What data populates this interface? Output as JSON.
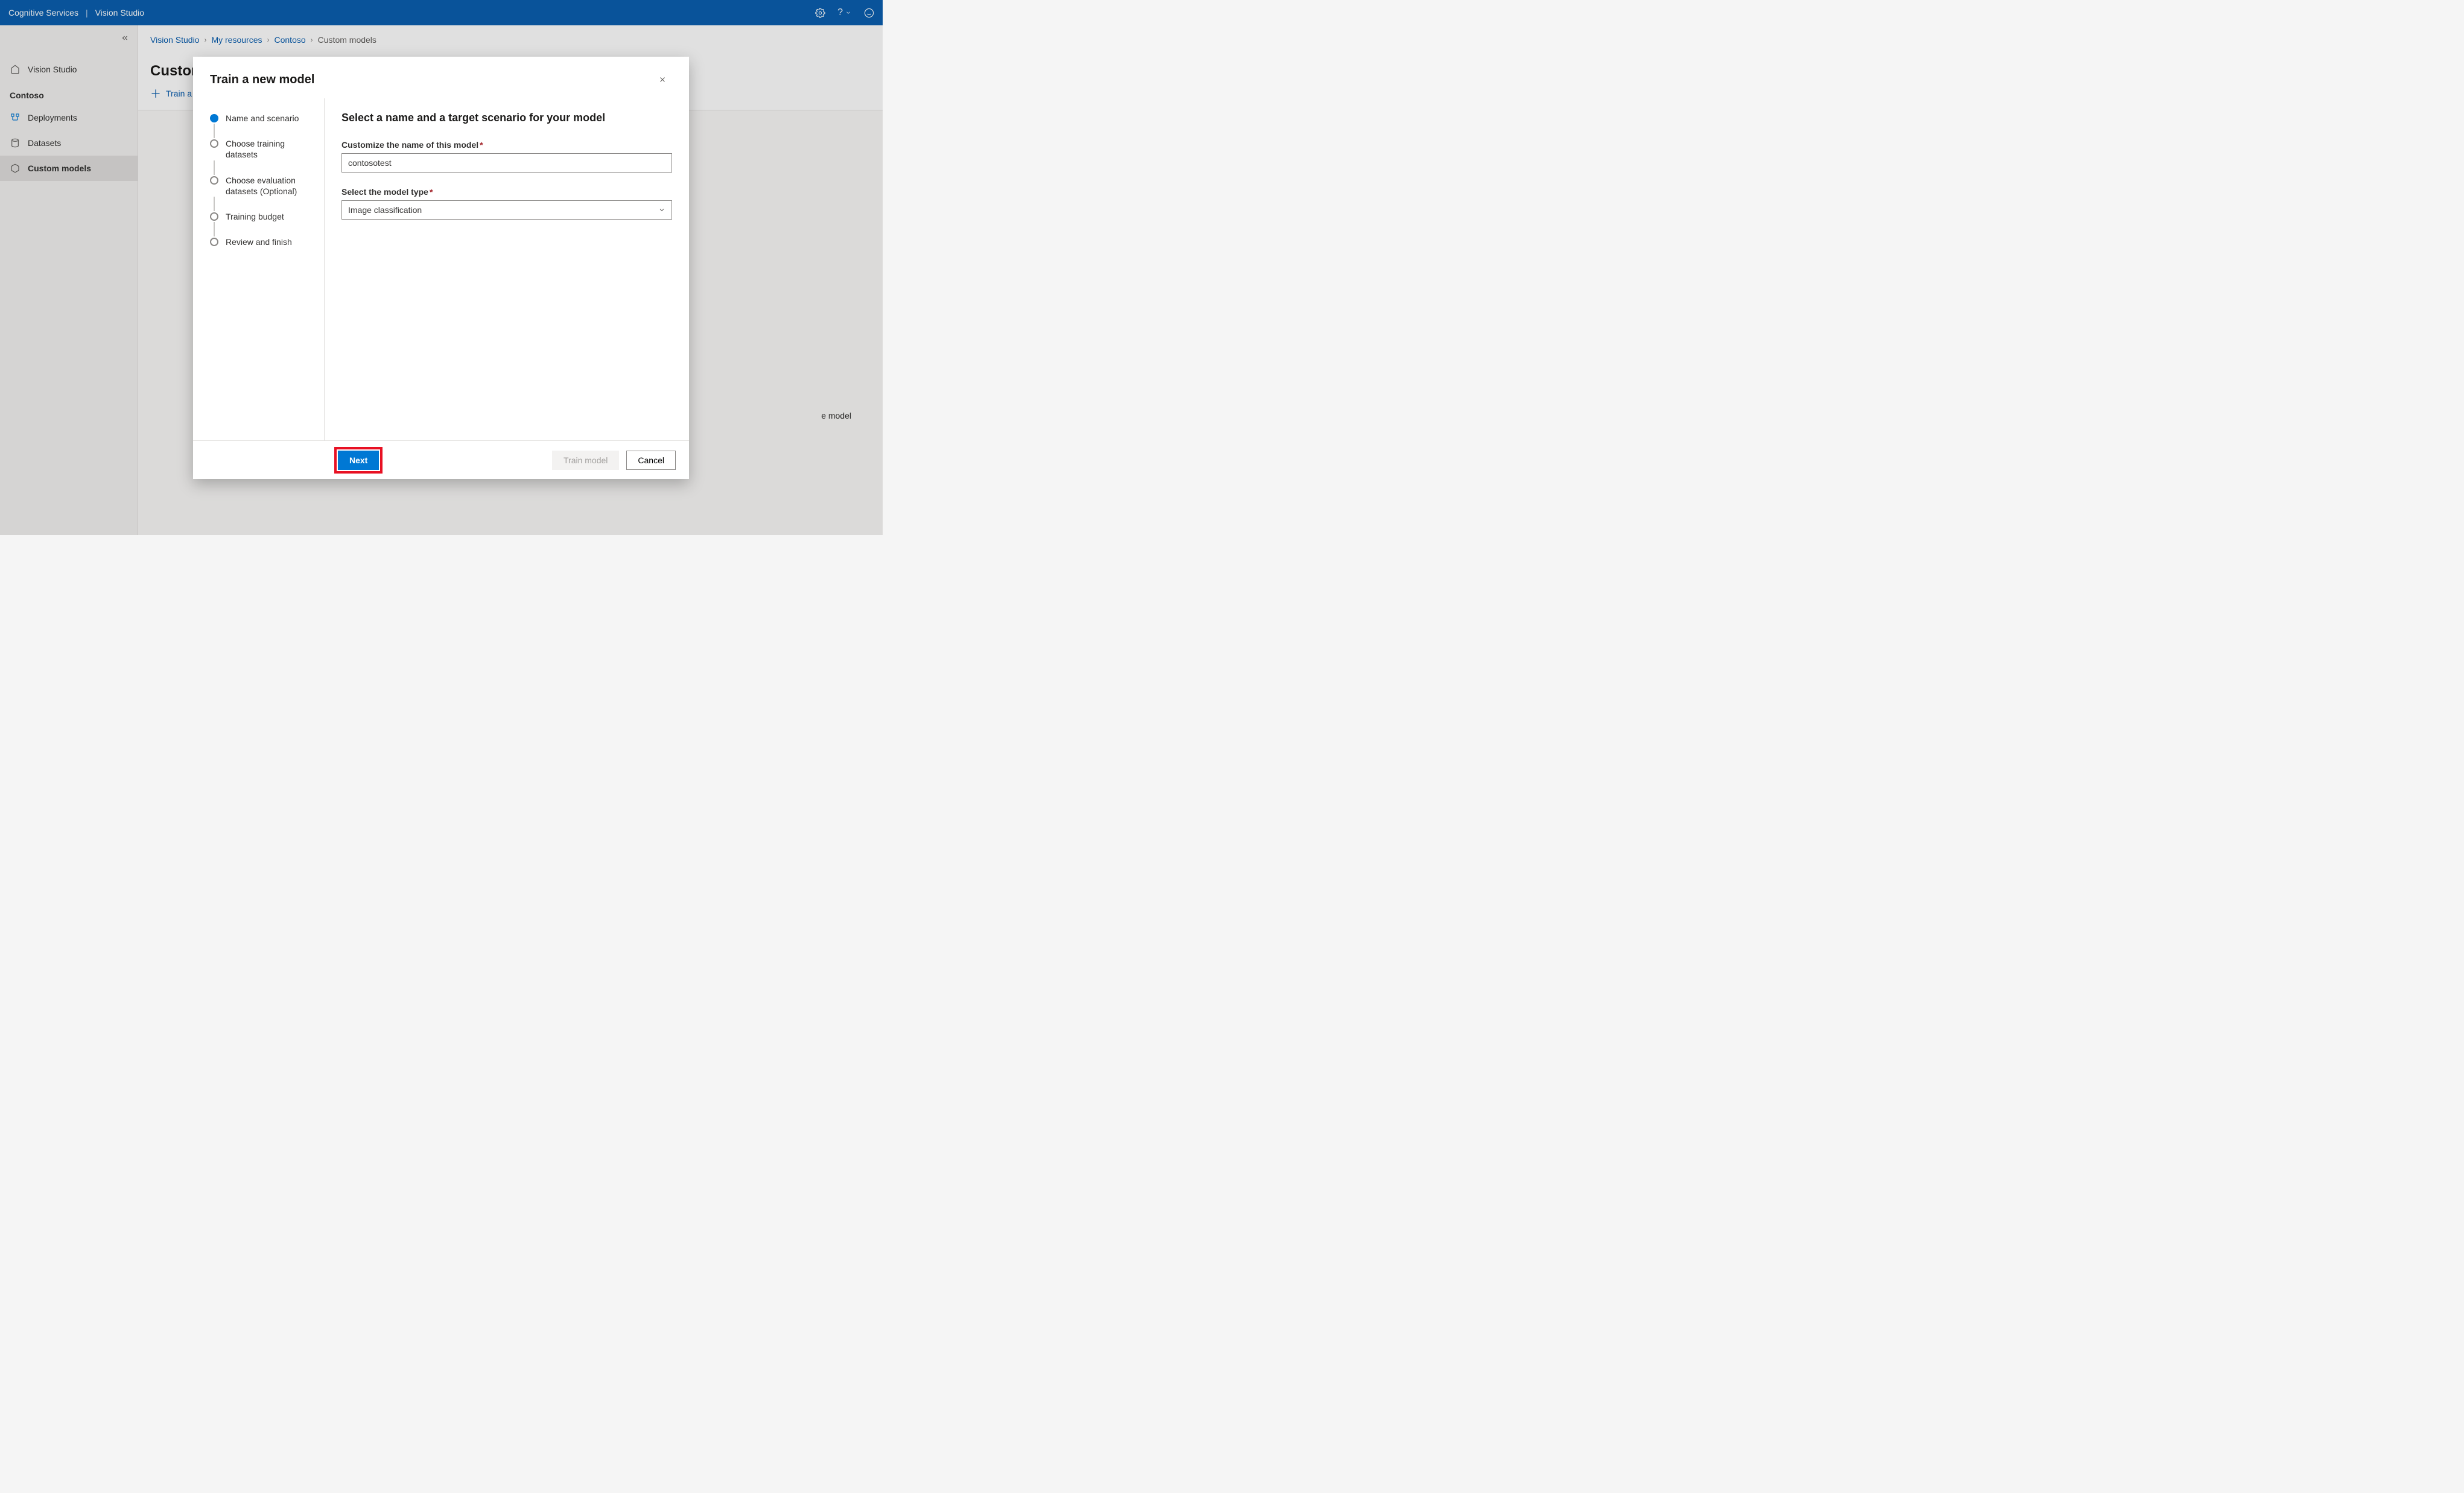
{
  "header": {
    "service": "Cognitive Services",
    "product": "Vision Studio"
  },
  "sidebar": {
    "home_label": "Vision Studio",
    "resource_label": "Contoso",
    "items": [
      {
        "label": "Deployments"
      },
      {
        "label": "Datasets"
      },
      {
        "label": "Custom models"
      }
    ]
  },
  "breadcrumbs": [
    "Vision Studio",
    "My resources",
    "Contoso",
    "Custom models"
  ],
  "page": {
    "title": "Custom",
    "train_link": "Train a",
    "peek_text": "e model"
  },
  "modal": {
    "title": "Train a new model",
    "steps": [
      "Name and scenario",
      "Choose training datasets",
      "Choose evaluation datasets (Optional)",
      "Training budget",
      "Review and finish"
    ],
    "content_heading": "Select a name and a target scenario for your model",
    "name_field_label": "Customize the name of this model",
    "name_field_value": "contosotest",
    "type_field_label": "Select the model type",
    "type_field_value": "Image classification",
    "buttons": {
      "next": "Next",
      "train": "Train model",
      "cancel": "Cancel"
    }
  }
}
